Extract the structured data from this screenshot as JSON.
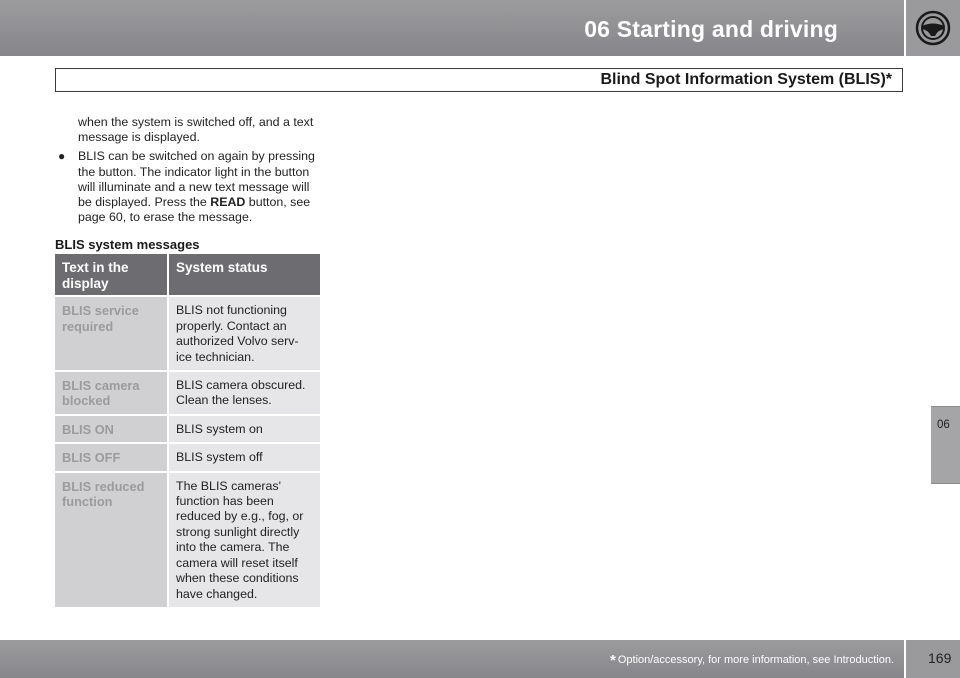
{
  "header": {
    "chapter_title": "06 Starting and driving",
    "section_title": "Blind Spot Information System (BLIS)*",
    "icon": "steering-wheel-icon"
  },
  "body": {
    "continuation": "when the system is switched off, and a text message is displayed.",
    "bullet_before": "BLIS can be switched on again by pressing the button. The indicator light in the button will illuminate and a new text message will be displayed. Press the ",
    "bullet_bold": "READ",
    "bullet_after": " button, see page 60, to erase the message.",
    "subheading": "BLIS system messages"
  },
  "table": {
    "headers": [
      "Text in the display",
      "System status"
    ],
    "rows": [
      {
        "display": "BLIS service required",
        "status": "BLIS not functioning properly. Contact an authorized Volvo serv-ice technician."
      },
      {
        "display": "BLIS camera blocked",
        "status": "BLIS camera obscured. Clean the lenses."
      },
      {
        "display": "BLIS ON",
        "status": "BLIS system on"
      },
      {
        "display": "BLIS OFF",
        "status": "BLIS system off"
      },
      {
        "display": "BLIS reduced function",
        "status": "The BLIS cameras' function has been reduced by e.g., fog, or strong sunlight directly into the camera. The camera will reset itself when these conditions have changed."
      }
    ]
  },
  "side_tab": "06",
  "footer": {
    "star": "*",
    "footnote": "Option/accessory, for more information, see Introduction.",
    "page_number": "169"
  }
}
